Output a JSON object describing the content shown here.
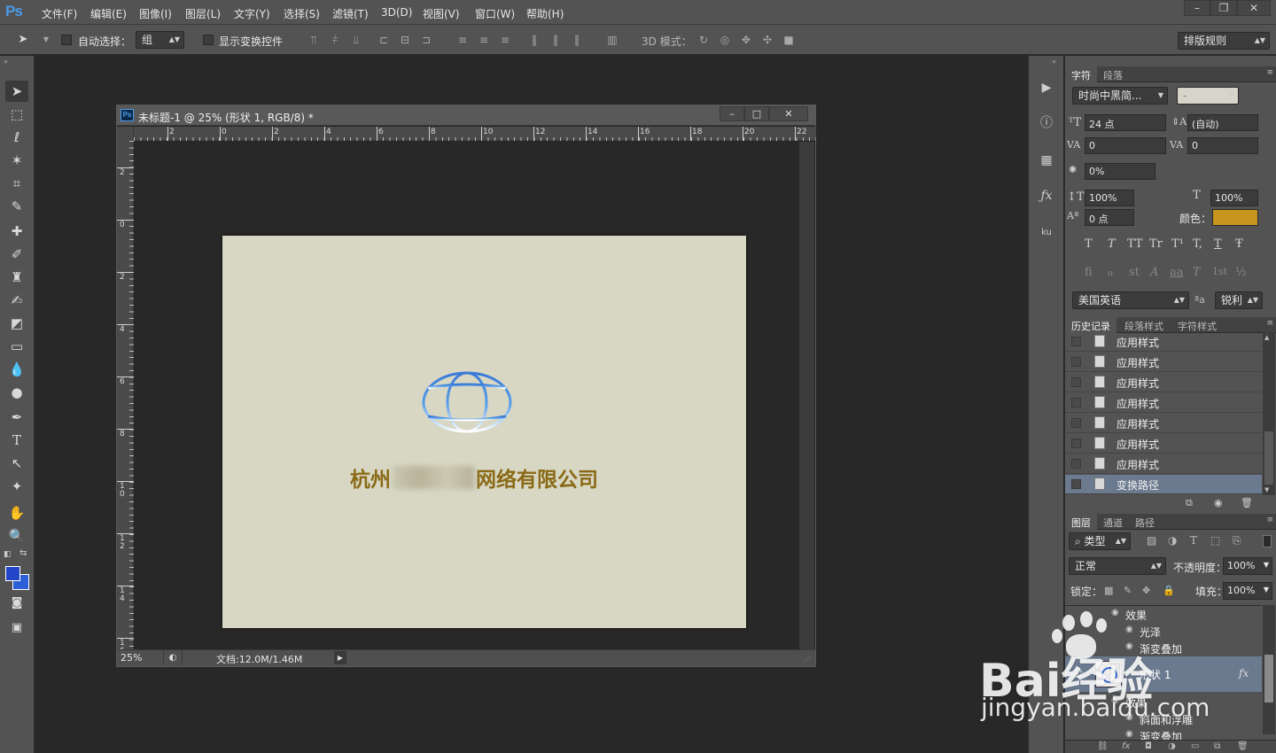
{
  "app": {
    "logo": "Ps"
  },
  "menu": [
    "文件(F)",
    "编辑(E)",
    "图像(I)",
    "图层(L)",
    "文字(Y)",
    "选择(S)",
    "滤镜(T)",
    "3D(D)",
    "视图(V)",
    "窗口(W)",
    "帮助(H)"
  ],
  "window_controls": {
    "minimize": "–",
    "restore": "❐",
    "close": "✕"
  },
  "options": {
    "auto_select_label": "自动选择：",
    "auto_select_value": "组",
    "show_transform_label": "显示变换控件",
    "mode3d_label": "3D 模式：",
    "workspace": "排版规则"
  },
  "document": {
    "icon": "Ps",
    "title": "未标题-1 @ 25% (形状 1, RGB/8) *",
    "zoom": "25%",
    "doc_info": "文档:12.0M/1.46M",
    "ruler_h": [
      "2",
      "0",
      "2",
      "4",
      "6",
      "8",
      "10",
      "12",
      "14",
      "16",
      "18",
      "20",
      "22"
    ],
    "ruler_v": [
      "2",
      "0",
      "2",
      "4",
      "6",
      "8",
      "10",
      "12",
      "14",
      "16"
    ],
    "artboard_text": "杭州",
    "artboard_text_tail": "网络有限公司",
    "artboard_color": "#d7d7c4",
    "text_color": "#8a6a16"
  },
  "character_panel": {
    "tabs": [
      "字符",
      "段落"
    ],
    "font_family": "时尚中黑简...",
    "font_style": "-",
    "size": "24 点",
    "leading": "(自动)",
    "kerning": "0",
    "tracking": "0",
    "tsume": "0%",
    "vscale": "100%",
    "hscale": "100%",
    "baseline": "0 点",
    "color_label": "颜色：",
    "color": "#c8961e",
    "glyphs1": [
      "T",
      "T",
      "TT",
      "Tr",
      "T¹",
      "T,",
      "T",
      "Ŧ"
    ],
    "glyphs2": [
      "fi",
      "ℴ",
      "st",
      "A",
      "aa",
      "T",
      "1st",
      "½"
    ],
    "language": "美国英语",
    "aa_label": "ªa",
    "antialias": "锐利"
  },
  "history_panel": {
    "tabs": [
      "历史记录",
      "段落样式",
      "字符样式"
    ],
    "items": [
      "应用样式",
      "应用样式",
      "应用样式",
      "应用样式",
      "应用样式",
      "应用样式",
      "应用样式",
      "变换路径"
    ]
  },
  "layers_panel": {
    "tabs": [
      "图层",
      "通道",
      "路径"
    ],
    "filter": "类型",
    "blend_mode": "正常",
    "opacity_label": "不透明度：",
    "opacity": "100%",
    "lock_label": "锁定：",
    "fill_label": "填充：",
    "fill": "100%",
    "rows": [
      {
        "name": "效果",
        "indent": 1
      },
      {
        "name": "光泽",
        "indent": 2
      },
      {
        "name": "渐变叠加",
        "indent": 2
      }
    ],
    "shape_layer": "形状 1",
    "fx": "fx",
    "rows2": [
      {
        "name": "效果",
        "indent": 1
      },
      {
        "name": "斜面和浮雕",
        "indent": 2
      },
      {
        "name": "渐变叠加",
        "indent": 2
      }
    ]
  },
  "watermark": {
    "brand": "Bai经验",
    "url": "jingyan.baidu.com"
  }
}
